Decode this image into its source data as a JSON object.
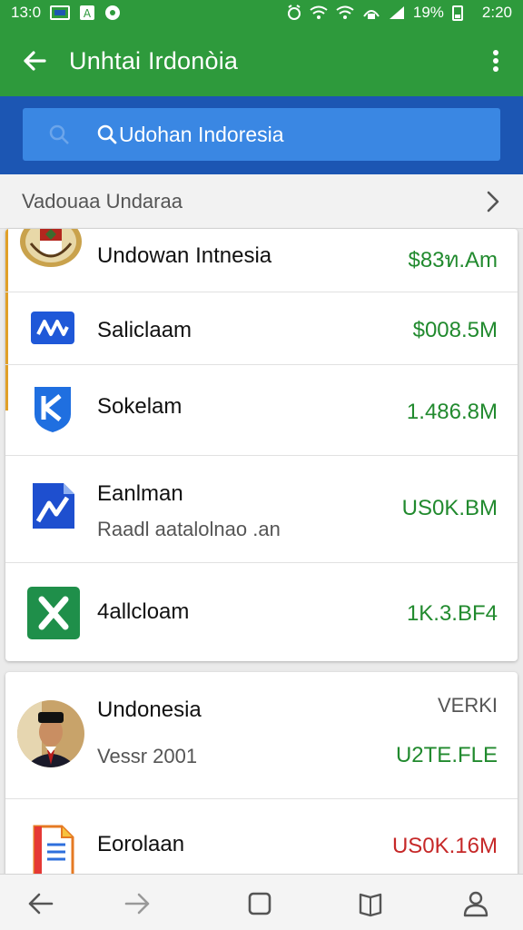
{
  "status_bar": {
    "time": "13:0",
    "battery": "19%",
    "clock": "2:20"
  },
  "app_bar": {
    "title": "Unhtai Irdonòia"
  },
  "search": {
    "text": "Udohan Indoresia"
  },
  "section": {
    "title": "Vadouaa Undaraa"
  },
  "list": [
    {
      "label": "Undowan Intnesia",
      "value": "$83ท.Am",
      "icon": "emblem-icon"
    },
    {
      "label": "Saliclaam",
      "value": "$008.5M",
      "icon": "wave-app-icon"
    },
    {
      "label": "Sokelam",
      "value": "1.486.8M",
      "icon": "k-shield-icon"
    },
    {
      "label": "Eanlman",
      "sublabel": "Raadl aatalolnao .an",
      "value": "US0K.BM",
      "icon": "chart-app-icon"
    },
    {
      "label": "4allcloam",
      "value": "1K.3.BF4",
      "icon": "excel-icon"
    }
  ],
  "card2": {
    "person": {
      "name": "Undonesia",
      "sublabel": "Vessr 2001",
      "badge": "VERKI",
      "value": "U2TE.FLE",
      "icon": "person-avatar"
    },
    "doc": {
      "label": "Eorolaan",
      "value": "US0K.16M",
      "icon": "document-icon"
    }
  },
  "colors": {
    "app_green": "#2e9a3c",
    "search_blue": "#1c56b3",
    "value_green": "#218a2e",
    "value_red": "#c62828",
    "accent": "#e0a028"
  }
}
